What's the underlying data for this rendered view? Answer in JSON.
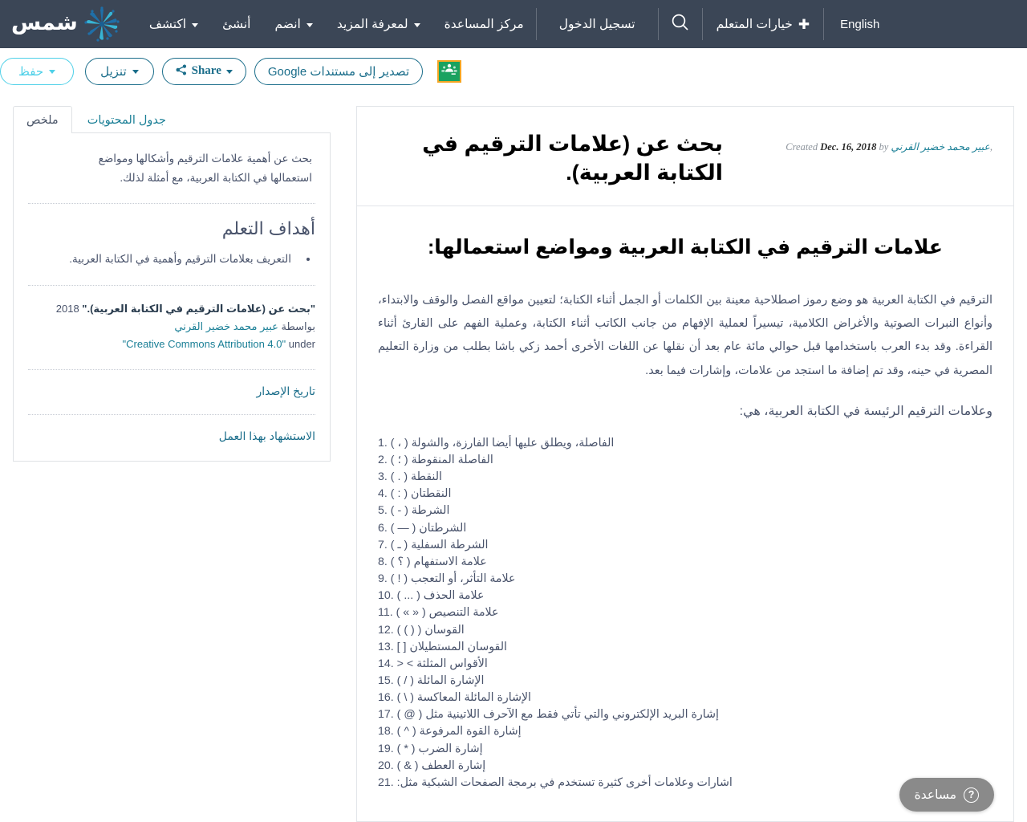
{
  "brand": {
    "name": "شمس",
    "logo_icon": "pinwheel-sun-icon"
  },
  "colors": {
    "nav_background": "#3b4656",
    "accent_teal": "#1a6d8a",
    "accent_cyan": "#4ed0e8",
    "link_teal": "#1a7f96",
    "body_text": "#49536b",
    "classroom_green": "#1aa260",
    "classroom_border": "#f5a623",
    "help_gray": "#8a8a8a"
  },
  "topnav": {
    "items": [
      {
        "label": "اكتشف",
        "has_caret": true
      },
      {
        "label": "أنشئ",
        "has_caret": false
      },
      {
        "label": "انضم",
        "has_caret": true
      },
      {
        "label": "لمعرفة المزيد",
        "has_caret": true
      },
      {
        "label": "مركز المساعدة",
        "has_caret": false
      }
    ],
    "login_label": "تسجيل الدخول",
    "search_icon": "search-icon",
    "learner_options_label": "خيارات المتعلم",
    "learner_options_icon": "plus-icon",
    "language_label": "English"
  },
  "toolbar": {
    "save_label": "حفظ",
    "download_label": "تنزيل",
    "share_label": "Share",
    "share_icon": "share-nodes-icon",
    "export_gdocs_label": "تصدير إلى مستندات Google",
    "classroom_label": "Google Classroom",
    "classroom_icon": "google-classroom-icon"
  },
  "sidebar": {
    "tabs": [
      {
        "label": "ملخص",
        "active": true
      },
      {
        "label": "جدول المحتويات",
        "active": false
      }
    ],
    "summary": "بحث عن أهمية علامات الترقيم وأشكالها ومواضع استعمالها في الكتابة العربية، مع أمثلة لذلك.",
    "objectives_heading": "أهداف التعلم",
    "objectives": [
      "التعريف بعلامات الترقيم وأهمية في الكتابة العربية."
    ],
    "attribution": {
      "work_title": "\"بحث عن (علامات الترقيم في الكتابة العربية).\"",
      "year": "2018",
      "by_label": "بواسطة",
      "author": "عبير محمد خضير القرني",
      "under_label": "under",
      "license": "\"Creative Commons Attribution 4.0\""
    },
    "links": [
      {
        "label": "تاريخ الإصدار"
      },
      {
        "label": "الاستشهاد بهذا العمل"
      }
    ]
  },
  "document": {
    "title": "بحث عن (علامات الترقيم في الكتابة العربية).",
    "meta": {
      "created_label": "Created",
      "created_date": "Dec. 16, 2018",
      "by_label": "by",
      "author": "عبير محمد خضير القرني",
      "trailing": ","
    },
    "section_title": "علامات الترقيم في الكتابة العربية ومواضع استعمالها:",
    "paragraph": "الترقيم في الكتابة العربية هو وضع رموز اصطلاحية معينة بين الكلمات أو الجمل أثناء الكتابة؛ لتعيين مواقع الفصل والوقف والابتداء، وأنواع النبرات الصوتية والأغراض الكلامية، تيسيراً لعملية الإفهام من جانب الكاتب أثناء الكتابة، وعملية الفهم على القارئ أثناء القراءة. وقد بدء العرب باستخدامها قبل حوالي مائة عام بعد أن نقلها عن اللغات الأخرى أحمد زكي باشا بطلب من وزارة التعليم المصرية في حينه، وقد تم إضافة ما استجد من علامات، وإشارات فيما بعد.",
    "list_intro": "وعلامات الترقيم الرئيسة في الكتابة العربية، هي:",
    "marks": [
      {
        "num": "1.",
        "text": "الفاصلة، ويطلق عليها أيضا الفارزة، والشولة ( ، )"
      },
      {
        "num": "2.",
        "text": "الفاصلة المنقوطة ( ؛ )"
      },
      {
        "num": "3.",
        "text": "النقطة ( . )"
      },
      {
        "num": "4.",
        "text": "النقطتان ( : )"
      },
      {
        "num": "5.",
        "text": "الشرطة ( - )"
      },
      {
        "num": "6.",
        "text": "الشرطتان ( — )"
      },
      {
        "num": "7.",
        "text": "الشرطة السفلية ( ـ )"
      },
      {
        "num": "8.",
        "text": "علامة الاستفهام ( ؟ )"
      },
      {
        "num": "9.",
        "text": "علامة التأثر، أو التعجب ( ! )"
      },
      {
        "num": "10.",
        "text": "علامة الحذف ( ... )"
      },
      {
        "num": "11.",
        "text": "علامة التنصيص ( « » )"
      },
      {
        "num": "12.",
        "text": "القوسان ( ( ) )"
      },
      {
        "num": "13.",
        "text": "القوسان المستطيلان [ ]"
      },
      {
        "num": "14.",
        "text": "الأقواس المثلثة > <"
      },
      {
        "num": "15.",
        "text": "الإشارة المائلة ( / )"
      },
      {
        "num": "16.",
        "text": "الإشارة المائلة المعاكسة ( \\ )"
      },
      {
        "num": "17.",
        "text": "إشارة البريد الإلكتروني والتي تأتي فقط مع الآحرف اللاتينية مثل ( @ )"
      },
      {
        "num": "18.",
        "text": "إشارة القوة المرفوعة ( ^ )"
      },
      {
        "num": "19.",
        "text": "إشارة الضرب ( * )"
      },
      {
        "num": "20.",
        "text": "إشارة العطف ( & )"
      },
      {
        "num": "21.",
        "text": "اشارات وعلامات أخرى كثيرة تستخدم في برمجة الصفحات الشبكية مثل:"
      }
    ]
  },
  "help": {
    "label": "مساعدة",
    "icon": "question-circle-icon"
  }
}
